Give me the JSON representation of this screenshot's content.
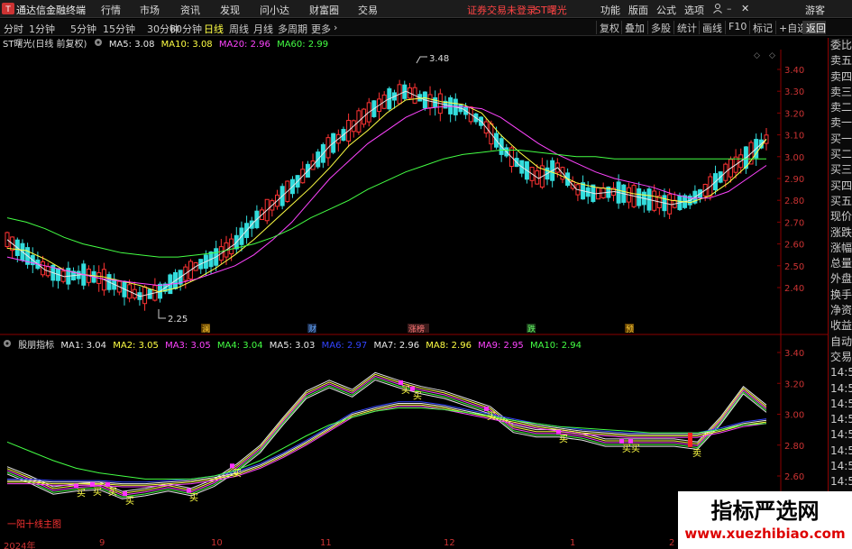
{
  "topbar": {
    "app_title": "通达信金融终端",
    "menu": [
      "行情",
      "市场",
      "资讯",
      "发现",
      "问小达",
      "财富圈",
      "交易"
    ],
    "notice": "证券交易未登录",
    "stock_tag": "ST曙光",
    "right_menu": [
      "功能",
      "版面",
      "公式",
      "选项"
    ],
    "guest": "游客"
  },
  "toolbar": {
    "periods": [
      "分时",
      "1分钟",
      "5分钟",
      "15分钟",
      "30分钟",
      "60分钟",
      "日线",
      "周线",
      "月线",
      "多周期",
      "更多"
    ],
    "active_period": "日线",
    "tools": [
      "复权",
      "叠加",
      "多股",
      "统计",
      "画线",
      "F10",
      "标记",
      "+自选",
      "返回"
    ]
  },
  "main_chart": {
    "title": "ST曙光(日线 前复权)",
    "legend": [
      {
        "label": "MA5: 3.08",
        "color": "#e8e8e8"
      },
      {
        "label": "MA10: 3.08",
        "color": "#ffff44"
      },
      {
        "label": "MA20: 2.96",
        "color": "#ff44ff"
      },
      {
        "label": "MA60: 2.99",
        "color": "#44ff44"
      }
    ],
    "y_ticks": [
      "3.40",
      "3.30",
      "3.20",
      "3.10",
      "3.00",
      "2.90",
      "2.80",
      "2.70",
      "2.60",
      "2.50",
      "2.40"
    ],
    "high_label": "3.48",
    "low_label": "2.25",
    "events": [
      "澜",
      "财",
      "涨榜",
      "跌",
      "预"
    ]
  },
  "sub_chart": {
    "title": "股朋指标",
    "legend": [
      {
        "label": "MA1: 3.04",
        "color": "#e8e8e8"
      },
      {
        "label": "MA2: 3.05",
        "color": "#ffff44"
      },
      {
        "label": "MA3: 3.05",
        "color": "#ff44ff"
      },
      {
        "label": "MA4: 3.04",
        "color": "#44ff44"
      },
      {
        "label": "MA5: 3.03",
        "color": "#e8e8e8"
      },
      {
        "label": "MA6: 2.97",
        "color": "#3344ff"
      },
      {
        "label": "MA7: 2.96",
        "color": "#e8e8e8"
      },
      {
        "label": "MA8: 2.96",
        "color": "#ffff44"
      },
      {
        "label": "MA9: 2.95",
        "color": "#ff44ff"
      },
      {
        "label": "MA10: 2.94",
        "color": "#44ff44"
      }
    ],
    "y_ticks": [
      "3.40",
      "3.20",
      "3.00",
      "2.80",
      "2.60"
    ],
    "buy_label": "买",
    "sell_label": "卖",
    "corner_label": "一阳十线主图"
  },
  "right_panel": {
    "items": [
      "委比",
      "卖五",
      "卖四",
      "卖三",
      "卖二",
      "卖一",
      "买一",
      "买二",
      "买三",
      "买四",
      "买五",
      "现价",
      "涨跌",
      "涨幅",
      "总量",
      "外盘",
      "换手",
      "净资",
      "收益",
      "自动",
      "交易",
      "14:53",
      "14:54",
      "14:54",
      "14:55",
      "14:55",
      "14:56",
      "14:56",
      "14:56"
    ]
  },
  "x_axis": [
    "2024年",
    "9",
    "10",
    "11",
    "12",
    "1",
    "2"
  ],
  "watermark": {
    "title": "指标严选网",
    "url": "www.xuezhibiao.com"
  },
  "chart_data": [
    {
      "type": "candlestick",
      "title": "ST曙光(日线 前复权)",
      "y_range": [
        2.2,
        3.5
      ],
      "series": [
        {
          "name": "MA5",
          "values": [
            2.62,
            2.55,
            2.48,
            2.45,
            2.46,
            2.44,
            2.4,
            2.36,
            2.38,
            2.44,
            2.5,
            2.54,
            2.6,
            2.7,
            2.78,
            2.86,
            2.95,
            3.05,
            3.12,
            3.2,
            3.26,
            3.3,
            3.26,
            3.24,
            3.22,
            3.16,
            3.05,
            2.96,
            2.9,
            2.95,
            2.85,
            2.83,
            2.84,
            2.82,
            2.8,
            2.78,
            2.8,
            2.86,
            2.94,
            3.0,
            3.08
          ]
        },
        {
          "name": "MA10",
          "values": [
            2.58,
            2.57,
            2.53,
            2.48,
            2.46,
            2.45,
            2.43,
            2.41,
            2.38,
            2.4,
            2.44,
            2.49,
            2.55,
            2.62,
            2.7,
            2.78,
            2.86,
            2.95,
            3.05,
            3.12,
            3.2,
            3.26,
            3.27,
            3.25,
            3.24,
            3.2,
            3.1,
            3.02,
            2.95,
            2.92,
            2.88,
            2.86,
            2.85,
            2.83,
            2.82,
            2.8,
            2.79,
            2.82,
            2.88,
            2.96,
            3.08
          ]
        },
        {
          "name": "MA20",
          "values": [
            2.54,
            2.52,
            2.5,
            2.48,
            2.46,
            2.44,
            2.43,
            2.42,
            2.41,
            2.42,
            2.44,
            2.47,
            2.5,
            2.55,
            2.62,
            2.7,
            2.8,
            2.9,
            2.98,
            3.06,
            3.12,
            3.18,
            3.22,
            3.23,
            3.23,
            3.22,
            3.18,
            3.12,
            3.06,
            3.01,
            2.97,
            2.93,
            2.9,
            2.88,
            2.86,
            2.83,
            2.81,
            2.81,
            2.84,
            2.9,
            2.96
          ]
        },
        {
          "name": "MA60",
          "values": [
            2.72,
            2.7,
            2.67,
            2.63,
            2.6,
            2.58,
            2.56,
            2.55,
            2.54,
            2.54,
            2.55,
            2.56,
            2.58,
            2.6,
            2.63,
            2.67,
            2.72,
            2.76,
            2.8,
            2.85,
            2.89,
            2.93,
            2.96,
            2.99,
            3.01,
            3.02,
            3.03,
            3.03,
            3.02,
            3.01,
            3.0,
            3.0,
            2.99,
            2.99,
            2.99,
            2.99,
            2.99,
            2.99,
            2.99,
            2.99,
            2.99
          ]
        }
      ]
    },
    {
      "type": "line",
      "title": "股朋指标",
      "y_range": [
        2.5,
        3.45
      ],
      "series": [
        {
          "name": "MA1",
          "values": [
            2.66,
            2.6,
            2.53,
            2.55,
            2.56,
            2.5,
            2.52,
            2.55,
            2.52,
            2.58,
            2.68,
            2.8,
            2.98,
            3.15,
            3.22,
            3.16,
            3.27,
            3.22,
            3.18,
            3.15,
            3.1,
            3.05,
            2.93,
            2.9,
            2.9,
            2.88,
            2.84,
            2.84,
            2.84,
            2.84,
            2.82,
            2.98,
            3.18,
            3.06
          ]
        },
        {
          "name": "MA6",
          "values": [
            2.58,
            2.58,
            2.57,
            2.57,
            2.57,
            2.56,
            2.56,
            2.57,
            2.58,
            2.6,
            2.63,
            2.68,
            2.75,
            2.83,
            2.92,
            3.01,
            3.05,
            3.08,
            3.08,
            3.06,
            3.03,
            3.0,
            2.97,
            2.94,
            2.92,
            2.9,
            2.89,
            2.88,
            2.88,
            2.88,
            2.88,
            2.91,
            2.95,
            2.97
          ]
        },
        {
          "name": "MA10",
          "values": [
            2.82,
            2.76,
            2.7,
            2.65,
            2.62,
            2.6,
            2.58,
            2.58,
            2.58,
            2.6,
            2.64,
            2.7,
            2.78,
            2.86,
            2.93,
            2.98,
            3.02,
            3.04,
            3.04,
            3.03,
            3.01,
            2.99,
            2.96,
            2.94,
            2.92,
            2.91,
            2.9,
            2.89,
            2.88,
            2.88,
            2.88,
            2.9,
            2.93,
            2.94
          ]
        }
      ]
    }
  ]
}
